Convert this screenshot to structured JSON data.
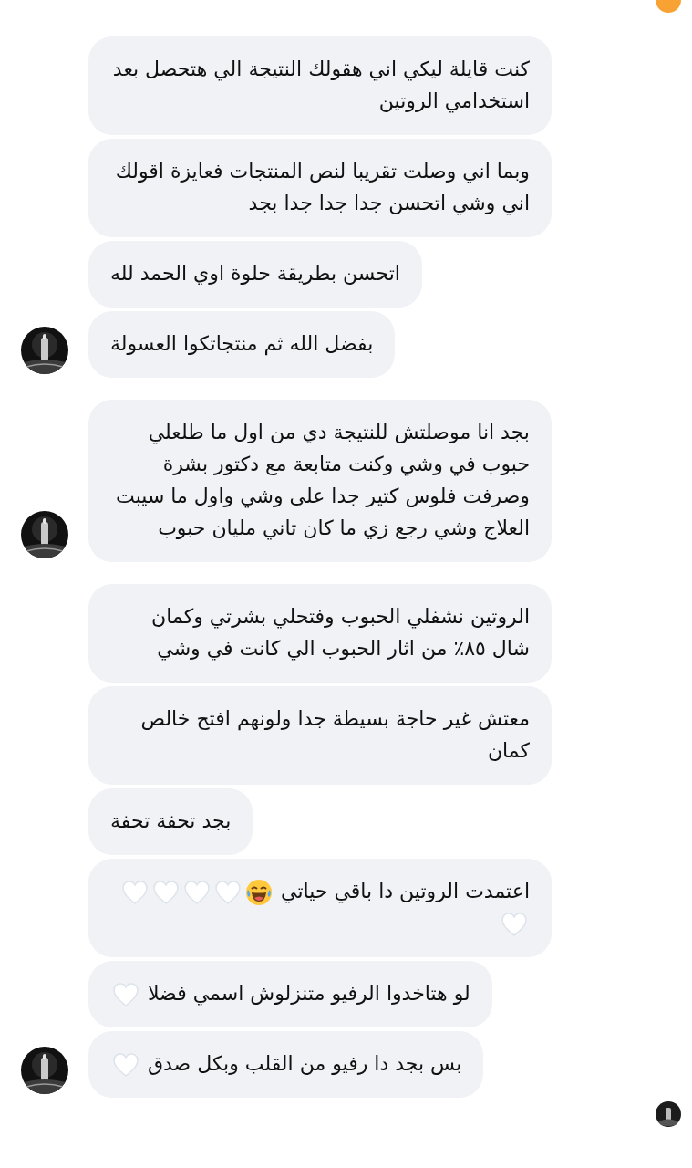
{
  "groups": [
    {
      "messages": [
        {
          "text": "كنت قايلة ليكي اني هقولك النتيجة الي هتحصل بعد استخدامي الروتين"
        },
        {
          "text": "وبما اني وصلت تقريبا لنص المنتجات فعايزة اقولك اني وشي اتحسن جدا جدا جدا بجد"
        },
        {
          "text": "اتحسن بطريقة حلوة اوي الحمد لله"
        },
        {
          "text": "بفضل الله ثم منتجاتكوا العسولة"
        }
      ]
    },
    {
      "messages": [
        {
          "text": "بجد انا موصلتش للنتيجة دي من اول ما طلعلي حبوب في وشي وكنت متابعة مع دكتور بشرة وصرفت فلوس كتير جدا على وشي واول ما سيبت العلاج وشي رجع زي ما كان تاني مليان حبوب"
        }
      ]
    },
    {
      "messages": [
        {
          "text": "الروتين نشفلي الحبوب وفتحلي بشرتي وكمان شال ٨٥٪ من اثار الحبوب الي كانت في وشي"
        },
        {
          "text": "معتش غير حاجة بسيطة جدا ولونهم افتح خالص كمان"
        },
        {
          "text": "بجد تحفة تحفة"
        },
        {
          "text": "اعتمدت الروتين دا باقي حياتي",
          "emoji": [
            {
              "kind": "laughing"
            },
            {
              "kind": "heart"
            },
            {
              "kind": "heart"
            },
            {
              "kind": "heart"
            },
            {
              "kind": "heart"
            },
            {
              "kind": "heart"
            }
          ]
        },
        {
          "text": "لو هتاخدوا الرفيو متنزلوش اسمي فضلا",
          "emoji": [
            {
              "kind": "heart"
            }
          ]
        },
        {
          "text": "بس بجد دا رفيو من القلب وبكل صدق",
          "emoji": [
            {
              "kind": "heart"
            }
          ]
        }
      ]
    }
  ]
}
